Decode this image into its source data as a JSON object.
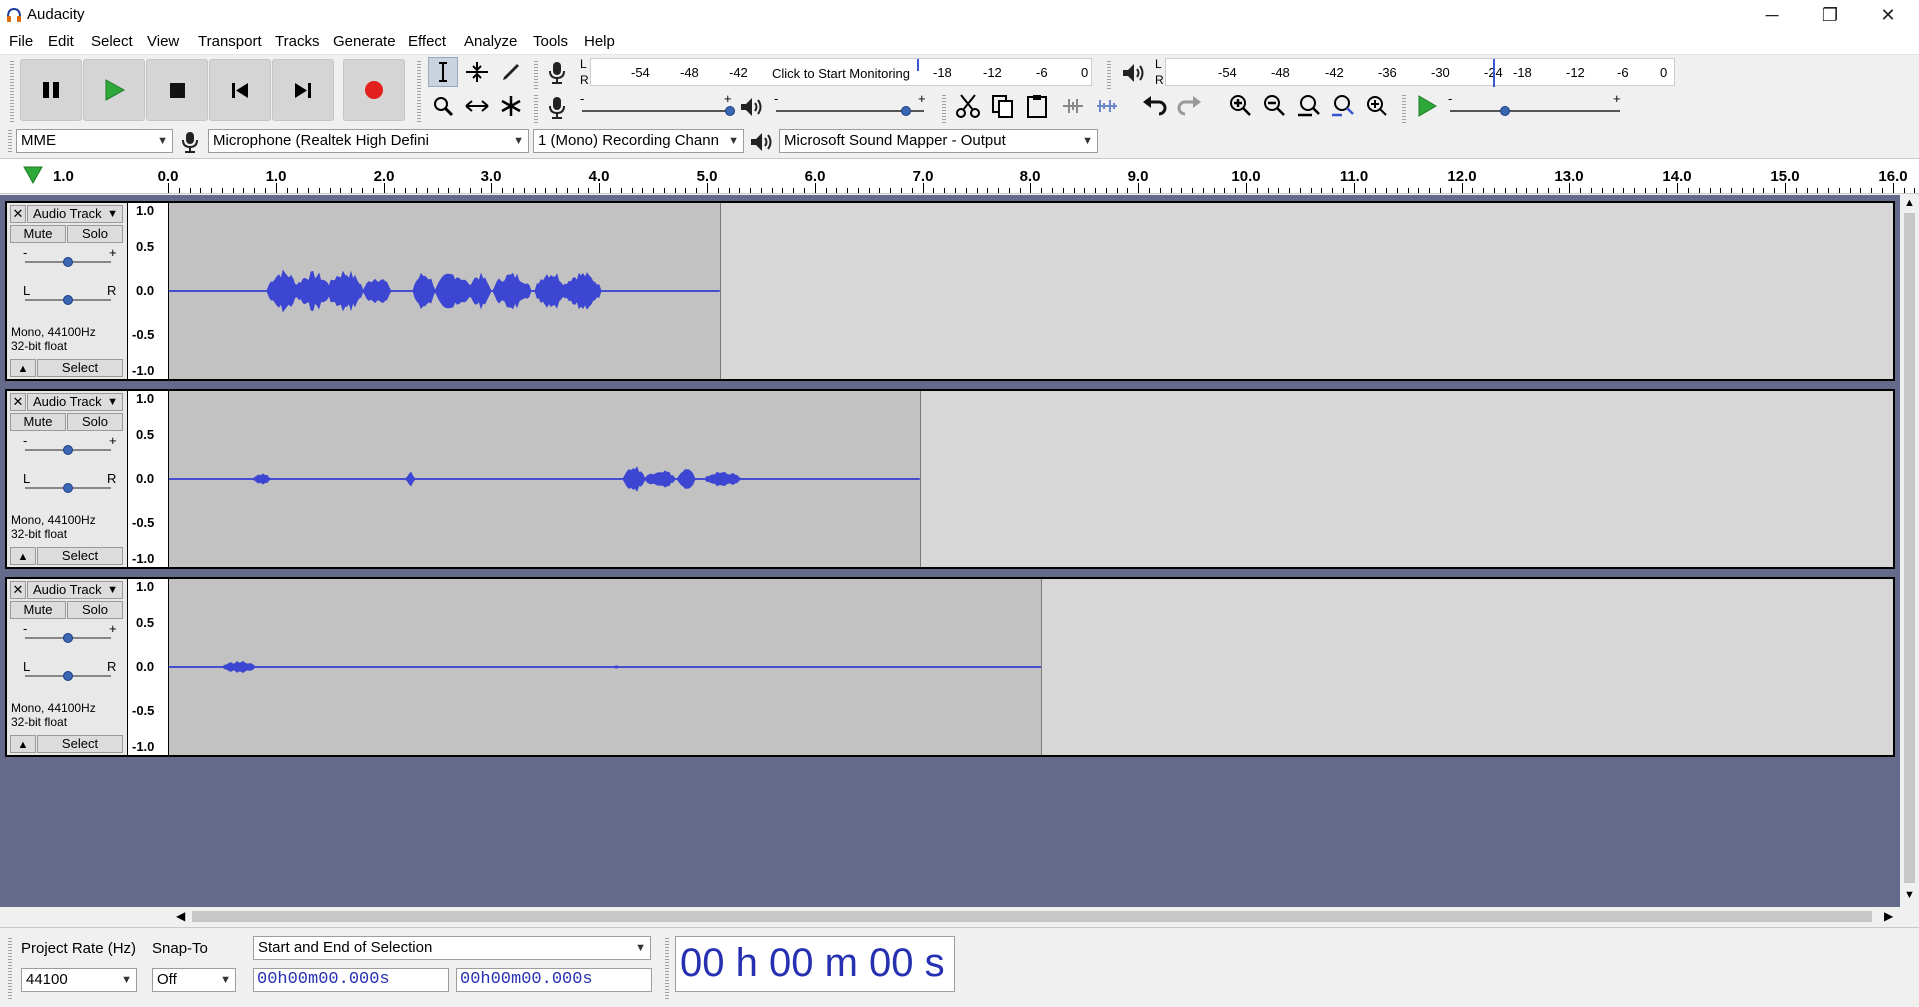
{
  "window": {
    "title": "Audacity",
    "minimize": "─",
    "maximize": "❐",
    "close": "✕"
  },
  "menu": [
    "File",
    "Edit",
    "Select",
    "View",
    "Transport",
    "Tracks",
    "Generate",
    "Effect",
    "Analyze",
    "Tools",
    "Help"
  ],
  "transport": {
    "pause": "pause-icon",
    "play": "play-icon",
    "stop": "stop-icon",
    "skip_start": "skip-to-start-icon",
    "skip_end": "skip-to-end-icon",
    "record": "record-icon"
  },
  "record_meter": {
    "ticks": [
      "-54",
      "-48",
      "-42",
      "-18",
      "-12",
      "-6",
      "0"
    ],
    "monitor_label": "Click to Start Monitoring",
    "channels": [
      "L",
      "R"
    ]
  },
  "play_meter": {
    "ticks": [
      "-54",
      "-48",
      "-42",
      "-36",
      "-30",
      "-24",
      "-18",
      "-12",
      "-6",
      "0"
    ],
    "channels": [
      "L",
      "R"
    ]
  },
  "mixer": {
    "rec_minus": "-",
    "rec_plus": "+",
    "play_minus": "-",
    "play_plus": "+"
  },
  "device": {
    "host": "MME",
    "input": "Microphone (Realtek High Defini",
    "channels": "1 (Mono) Recording Chann",
    "output": "Microsoft Sound Mapper - Output"
  },
  "ruler": {
    "start_label": "1.0",
    "labels": [
      "0.0",
      "1.0",
      "2.0",
      "3.0",
      "4.0",
      "5.0",
      "6.0",
      "7.0",
      "8.0",
      "9.0",
      "10.0",
      "11.0",
      "12.0",
      "13.0",
      "14.0",
      "15.0",
      "16.0"
    ]
  },
  "tracks": [
    {
      "name": "Audio Track",
      "mute": "Mute",
      "solo": "Solo",
      "gain_minus": "-",
      "gain_plus": "+",
      "pan_left": "L",
      "pan_right": "R",
      "info_line1": "Mono, 44100Hz",
      "info_line2": "32-bit float",
      "select": "Select",
      "scale": [
        "1.0",
        "0.5",
        "0.0",
        "-0.5",
        "-1.0"
      ]
    },
    {
      "name": "Audio Track",
      "mute": "Mute",
      "solo": "Solo",
      "gain_minus": "-",
      "gain_plus": "+",
      "pan_left": "L",
      "pan_right": "R",
      "info_line1": "Mono, 44100Hz",
      "info_line2": "32-bit float",
      "select": "Select",
      "scale": [
        "1.0",
        "0.5",
        "0.0",
        "-0.5",
        "-1.0"
      ]
    },
    {
      "name": "Audio Track",
      "mute": "Mute",
      "solo": "Solo",
      "gain_minus": "-",
      "gain_plus": "+",
      "pan_left": "L",
      "pan_right": "R",
      "info_line1": "Mono, 44100Hz",
      "info_line2": "32-bit float",
      "select": "Select",
      "scale": [
        "1.0",
        "0.5",
        "0.0",
        "-0.5",
        "-1.0"
      ]
    }
  ],
  "selection": {
    "rate_label": "Project Rate (Hz)",
    "rate_value": "44100",
    "snap_label": "Snap-To",
    "snap_value": "Off",
    "mode": "Start and End of Selection",
    "start_time": "00h00m00.000s",
    "end_time": "00h00m00.000s",
    "audio_position": "00 h 00 m 00 s"
  },
  "colors": {
    "waveform": "#3c46d2",
    "clip": "#c2c2c2",
    "background": "#646a8a"
  }
}
